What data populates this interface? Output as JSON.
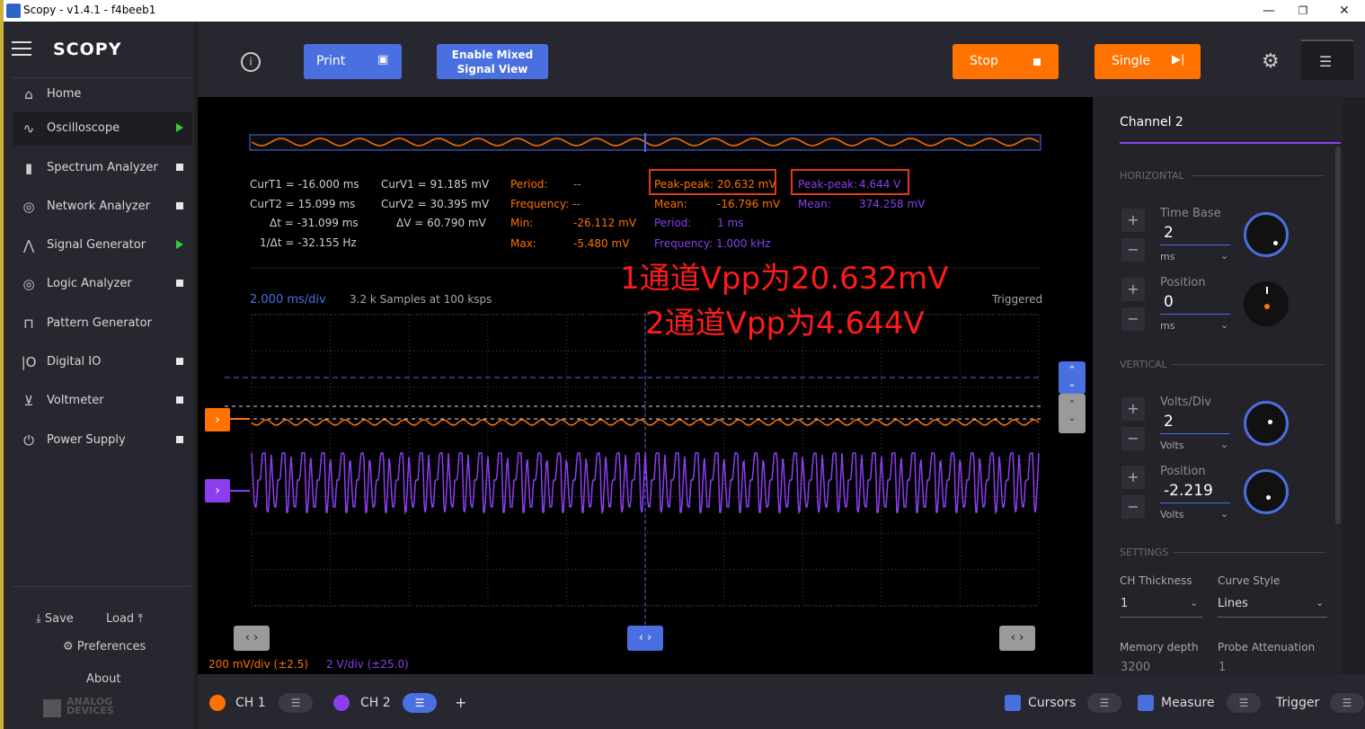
{
  "window": {
    "title": "Scopy - v1.4.1 - f4beeb1",
    "minimize": "—",
    "maximize": "❐",
    "close": "✕"
  },
  "sidebar": {
    "logo": "SCOPY",
    "items": [
      {
        "label": "Home"
      },
      {
        "label": "Oscilloscope"
      },
      {
        "label": "Spectrum Analyzer"
      },
      {
        "label": "Network Analyzer"
      },
      {
        "label": "Signal Generator"
      },
      {
        "label": "Logic Analyzer"
      },
      {
        "label": "Pattern Generator"
      },
      {
        "label": "Digital IO"
      },
      {
        "label": "Voltmeter"
      },
      {
        "label": "Power Supply"
      }
    ],
    "save": "Save",
    "load": "Load",
    "preferences": "Preferences",
    "about": "About",
    "brand_line1": "ANALOG",
    "brand_line2": "DEVICES"
  },
  "toolbar": {
    "print": "Print",
    "mixed_1": "Enable Mixed",
    "mixed_2": "Signal View",
    "stop": "Stop",
    "single": "Single"
  },
  "measure": {
    "curT1": "CurT1 = -16.000 ms",
    "curT2": "CurT2 = 15.099 ms",
    "dt": "Δt = -31.099 ms",
    "inv_dt": "1/Δt = -32.155 Hz",
    "curV1": "CurV1 = 91.185 mV",
    "curV2": "CurV2 = 30.395 mV",
    "dv": "ΔV = 60.790 mV",
    "ch1": {
      "period_l": "Period:",
      "period_v": "--",
      "freq_l": "Frequency:",
      "freq_v": "--",
      "min_l": "Min:",
      "min_v": "-26.112 mV",
      "max_l": "Max:",
      "max_v": "-5.480 mV",
      "pp_l": "Peak-peak:",
      "pp_v": "20.632 mV",
      "mean_l": "Mean:",
      "mean_v": "-16.796 mV"
    },
    "ch2": {
      "pp_l": "Peak-peak:",
      "pp_v": "4.644 V",
      "mean_l": "Mean:",
      "mean_v": "374.258 mV",
      "period_l": "Period:",
      "period_v": "1 ms",
      "freq_l": "Frequency:",
      "freq_v": "1.000 kHz"
    }
  },
  "annotation": {
    "line1": "1通道Vpp为20.632mV",
    "line2": "2通道Vpp为4.644V"
  },
  "plot": {
    "timebase": "2.000 ms/div",
    "samples": "3.2 k Samples at 100 ksps",
    "status": "Triggered",
    "ch1_scale": "200 mV/div (±2.5)",
    "ch2_scale": "2 V/div (±25.0)"
  },
  "right_panel": {
    "title": "Channel 2",
    "horizontal": "HORIZONTAL",
    "time_base_l": "Time Base",
    "time_base_v": "2",
    "time_base_u": "ms",
    "position_l": "Position",
    "position_v": "0",
    "position_u": "ms",
    "vertical": "VERTICAL",
    "volts_l": "Volts/Div",
    "volts_v": "2",
    "volts_u": "Volts",
    "vpos_l": "Position",
    "vpos_v": "-2.219",
    "vpos_u": "Volts",
    "settings": "SETTINGS",
    "thick_l": "CH Thickness",
    "thick_v": "1",
    "curve_l": "Curve Style",
    "curve_v": "Lines",
    "mem_l": "Memory depth",
    "mem_v": "3200",
    "probe_l": "Probe Attenuation",
    "probe_v": "1"
  },
  "bottom": {
    "ch1": "CH 1",
    "ch2": "CH 2",
    "add": "+",
    "cursors": "Cursors",
    "measure": "Measure",
    "trigger": "Trigger"
  },
  "colors": {
    "ch1": "#ff7200",
    "ch2": "#8b3ef0",
    "accent": "#4a6fe0",
    "stop": "#ff7200"
  }
}
